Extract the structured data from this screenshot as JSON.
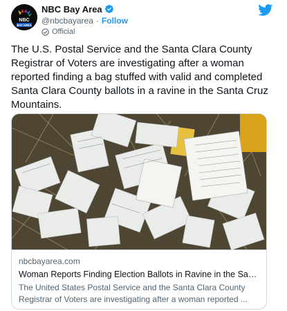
{
  "account": {
    "display_name": "NBC Bay Area",
    "handle": "@nbcbayarea",
    "separator": "·",
    "follow_label": "Follow",
    "official_label": "Official",
    "avatar_text": "NBC\nBAY AREA"
  },
  "tweet": {
    "text": "The U.S. Postal Service and the Santa Clara County Registrar of Voters are investigating after a woman reported finding a bag stuffed with valid and completed Santa Clara County ballots in a ravine in the Santa Cruz Mountains."
  },
  "card": {
    "domain": "nbcbayarea.com",
    "title": "Woman Reports Finding Election Ballots in Ravine in the Santa C...",
    "description": "The United States Postal Service and the Santa Clara County Registrar of Voters are investigating after a woman reported ..."
  },
  "colors": {
    "accent": "#1d9bf0",
    "text_primary": "#0f1419",
    "text_secondary": "#536471",
    "border": "#cfd9de"
  },
  "icons": {
    "verified": "verified-badge-icon",
    "official": "official-badge-icon",
    "twitter": "twitter-bird-icon"
  }
}
